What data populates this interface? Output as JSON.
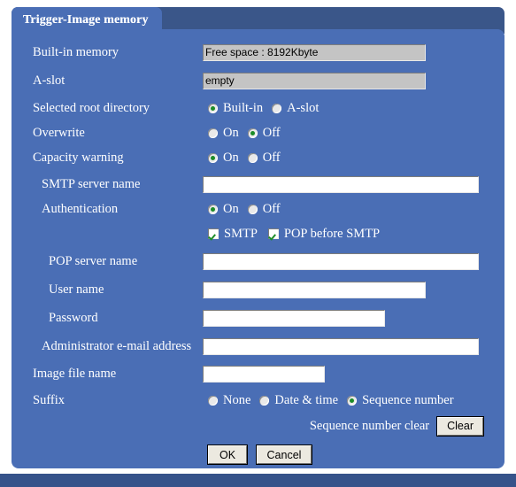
{
  "window": {
    "tab_title": "Trigger-Image memory",
    "accent_color": "#4a6eb5",
    "tab_strip_color": "#3a5689",
    "footer_color": "#36538a",
    "check_color": "#1c8c28"
  },
  "rows": {
    "builtin_memory": {
      "label": "Built-in memory",
      "value": "Free space : 8192Kbyte"
    },
    "a_slot": {
      "label": "A-slot",
      "value": "empty"
    },
    "selected_root_directory": {
      "label": "Selected root directory",
      "options": [
        "Built-in",
        "A-slot"
      ],
      "selected": "Built-in"
    },
    "overwrite": {
      "label": "Overwrite",
      "options": [
        "On",
        "Off"
      ],
      "selected": "Off"
    },
    "capacity_warning": {
      "label": "Capacity warning",
      "options": [
        "On",
        "Off"
      ],
      "selected": "On"
    },
    "smtp_server_name": {
      "label": "SMTP server name",
      "value": "",
      "placeholder": ""
    },
    "authentication": {
      "label": "Authentication",
      "options": [
        "On",
        "Off"
      ],
      "selected": "On"
    },
    "auth_methods": {
      "items": [
        {
          "label": "SMTP",
          "checked": true
        },
        {
          "label": "POP before SMTP",
          "checked": true
        }
      ]
    },
    "pop_server_name": {
      "label": "POP server name",
      "value": "",
      "placeholder": ""
    },
    "user_name": {
      "label": "User name",
      "value": "",
      "placeholder": ""
    },
    "password": {
      "label": "Password",
      "value": "",
      "placeholder": ""
    },
    "administrator_email": {
      "label": "Administrator e-mail address",
      "value": "",
      "placeholder": ""
    },
    "image_file_name": {
      "label": "Image file name",
      "value": "",
      "placeholder": ""
    },
    "suffix": {
      "label": "Suffix",
      "options": [
        "None",
        "Date & time",
        "Sequence number"
      ],
      "selected": "Sequence number"
    },
    "sequence_number_clear": {
      "label": "Sequence number clear",
      "button_label": "Clear"
    }
  },
  "actions": {
    "ok_label": "OK",
    "cancel_label": "Cancel"
  }
}
